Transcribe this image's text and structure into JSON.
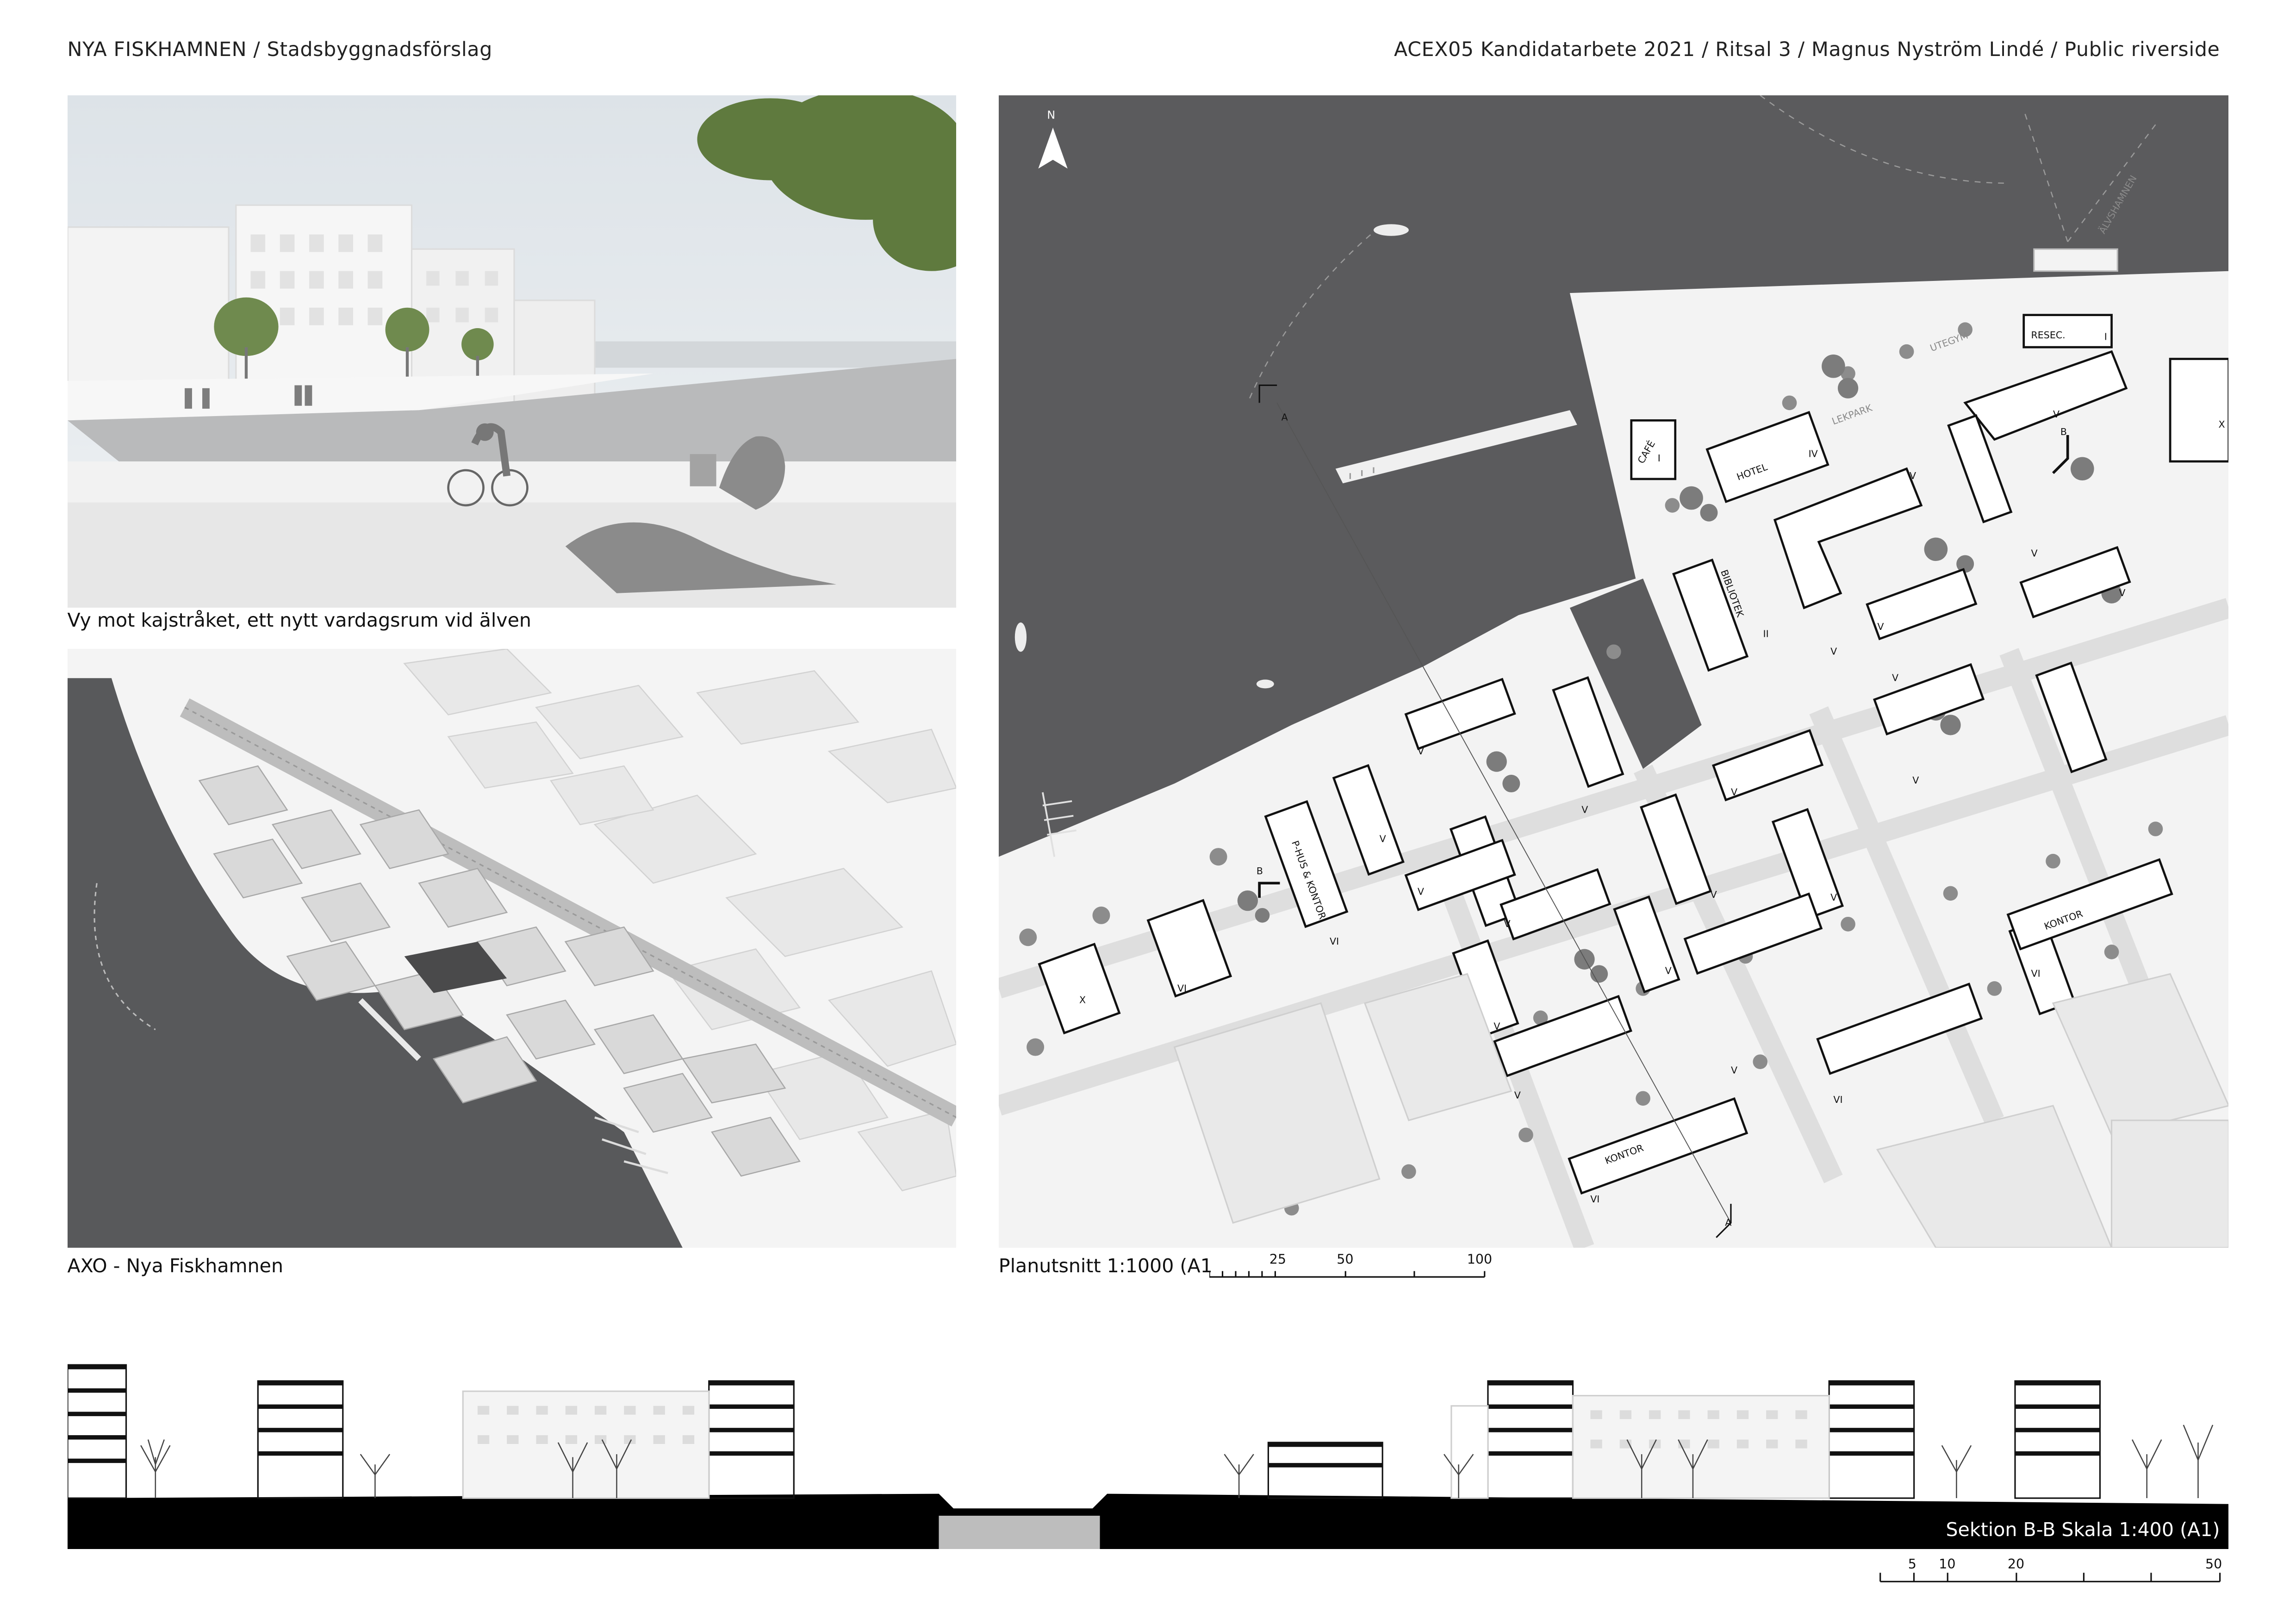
{
  "header": {
    "left": "NYA FISKHAMNEN / Stadsbyggnadsförslag",
    "right": "ACEX05 Kandidatarbete 2021 / Ritsal 3 / Magnus Nyström Lindé / Public riverside"
  },
  "captions": {
    "view": "Vy mot kajstråket, ett nytt vardagsrum vid älven",
    "axo": "AXO - Nya Fiskhamnen",
    "plan": "Planutsnitt 1:1000 (A1",
    "section": "Sektion B-B Skala 1:400 (A1)"
  },
  "plan": {
    "north": "N",
    "labels": {
      "cafe": "CAFÉ",
      "hotel": "HOTEL",
      "bibliotek": "BIBLIOTEK",
      "resec": "RESEC.",
      "phus": "P-HUS & KONTOR",
      "kontor": "KONTOR",
      "lekpark": "LEKPARK",
      "utegym": "UTEGYM",
      "alvshamnen": "ÄLVSHAMNEN"
    },
    "floors": {
      "I": "I",
      "II": "II",
      "IV": "IV",
      "V": "V",
      "VI": "VI",
      "X": "X"
    },
    "section_marks": {
      "a": "A",
      "b": "B"
    }
  },
  "scale_plan": {
    "ticks": [
      "25",
      "50",
      "100"
    ]
  },
  "scale_section": {
    "ticks": [
      "5",
      "10",
      "20",
      "50"
    ]
  },
  "colors": {
    "water": "#5b5b5d",
    "ground": "#f2f2f2",
    "block": "#e3e3e3",
    "tree": "#8c8c8c",
    "ink": "#111111"
  }
}
